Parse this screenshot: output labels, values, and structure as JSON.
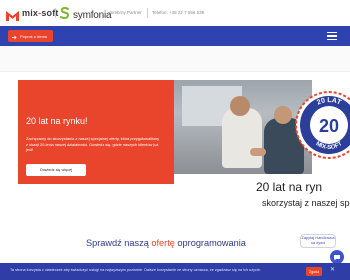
{
  "header": {
    "logo_left": {
      "text_a": "mix",
      "dash": "-",
      "text_b": "soft",
      "icon": "m-logo-icon"
    },
    "logo_right": {
      "text": "symfonia",
      "icon": "symfonia-logo-icon"
    },
    "partner": "Srebrny Partner",
    "phone": "Telefon: +48 22 7 556 538"
  },
  "nav": {
    "demo_label": "Poproś o demo",
    "demo_icon": "arrow-right-icon",
    "menu_icon": "hamburger-icon"
  },
  "hero": {
    "title": "20 lat na rynku!",
    "description": "Zachęcamy do skorzystania z naszej specjalnej oferty, która przygotowaliśmy z okazji 20-lecia naszej działalności. Dowiedz się, gdzie naszych klientów już jest!",
    "button": "Dowiedz się więcej",
    "badge": {
      "top": "20 LAT",
      "number": "20",
      "bottom": "MIX-SOFT"
    },
    "headline": "20 lat na ryn",
    "subheadline": "skorzystaj z naszej specjalne"
  },
  "section": {
    "title_part1": "Sprawdź naszą ",
    "title_highlight": "ofertę",
    "title_part2": " oprogramowania"
  },
  "chat": {
    "bubble_text": "Zapytaj Handlowca na żywo",
    "icon": "chat-icon"
  },
  "cookie": {
    "message": "Ta strona korzysta z ciasteczek aby świadczyć usługi na najwyższym poziomie. Dalsze korzystanie ze strony oznacza, że zgadzasz się na ich użycie.",
    "ok_label": "Zgoda",
    "close_icon": "close-icon"
  },
  "colors": {
    "brand_orange": "#e8452c",
    "nav_blue": "#2f43b0",
    "cookie_blue": "#2e3ea6",
    "heading_blue": "#2d3a8c"
  }
}
